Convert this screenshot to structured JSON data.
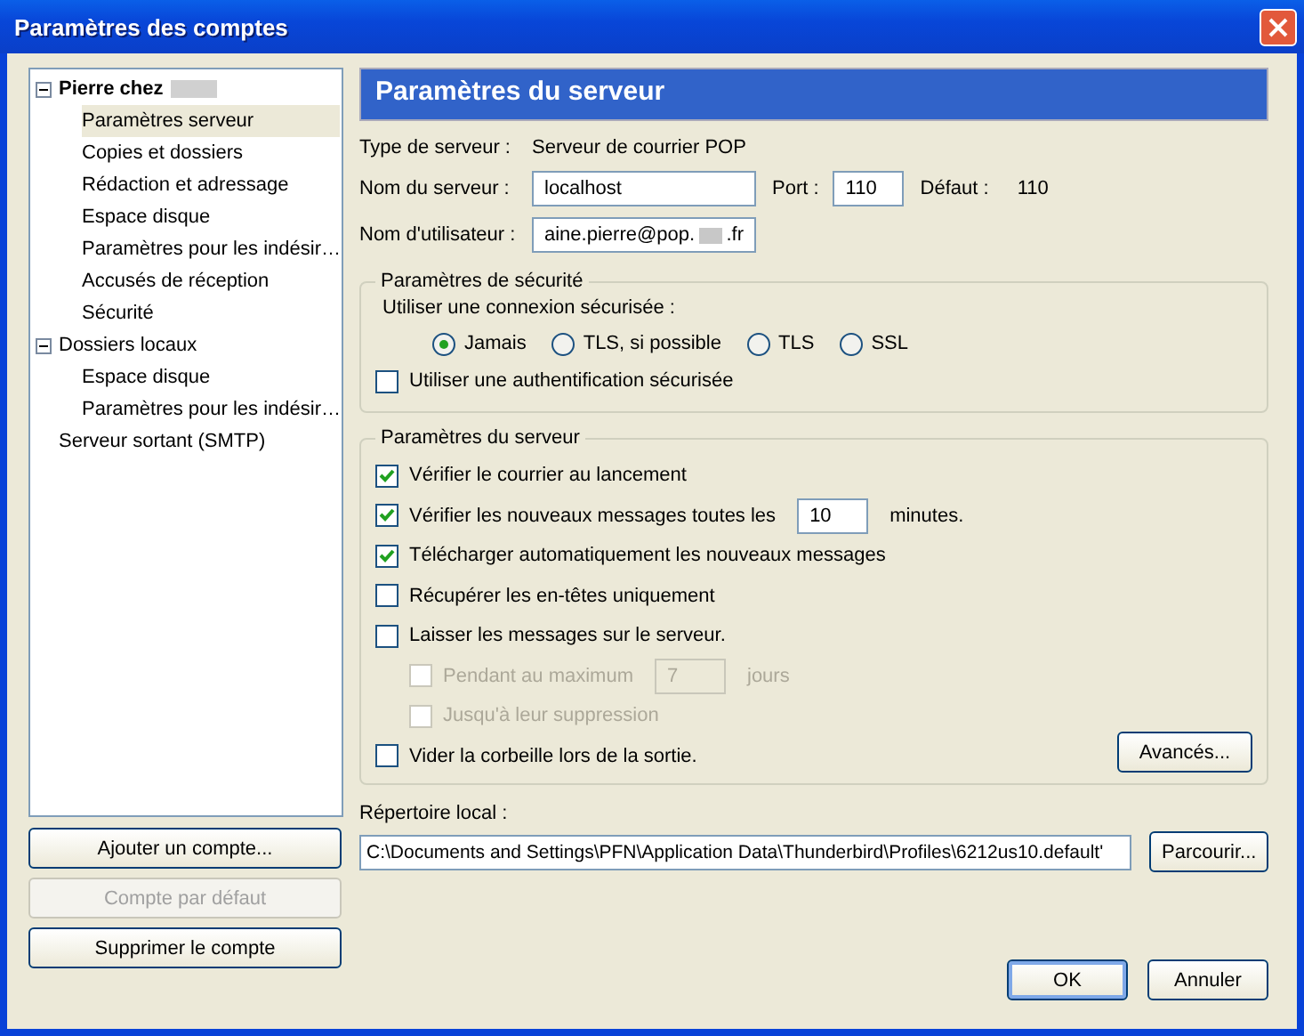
{
  "window": {
    "title": "Paramètres des comptes"
  },
  "tree": [
    {
      "label": "Pierre chez",
      "bold": true,
      "selected": false,
      "expanded": true,
      "children": [
        {
          "label": "Paramètres serveur",
          "selected": true
        },
        {
          "label": "Copies et dossiers",
          "selected": false
        },
        {
          "label": "Rédaction et adressage",
          "selected": false
        },
        {
          "label": "Espace disque",
          "selected": false
        },
        {
          "label": "Paramètres pour les indésir…",
          "selected": false
        },
        {
          "label": "Accusés de réception",
          "selected": false
        },
        {
          "label": "Sécurité",
          "selected": false
        }
      ]
    },
    {
      "label": "Dossiers locaux",
      "bold": false,
      "selected": false,
      "expanded": true,
      "children": [
        {
          "label": "Espace disque",
          "selected": false
        },
        {
          "label": "Paramètres pour les indésir…",
          "selected": false
        }
      ]
    },
    {
      "label": "Serveur sortant (SMTP)",
      "bold": false,
      "selected": false
    }
  ],
  "left_buttons": [
    {
      "label": "Ajouter un compte...",
      "disabled": false
    },
    {
      "label": "Compte par défaut",
      "disabled": true
    },
    {
      "label": "Supprimer le compte",
      "disabled": false
    }
  ],
  "panel": {
    "title": "Paramètres du serveur"
  },
  "server_type": {
    "label": "Type de serveur :",
    "value": "Serveur de courrier POP"
  },
  "server_name": {
    "label": "Nom du serveur :",
    "value": "localhost"
  },
  "port": {
    "label": "Port :",
    "value": "110"
  },
  "default_port": {
    "label": "Défaut :",
    "value": "110"
  },
  "username": {
    "label": "Nom d'utilisateur :",
    "value_start": "aine.pierre@pop.",
    "value_end": ".fr"
  },
  "security": {
    "title": "Paramètres de sécurité",
    "prompt": "Utiliser une connexion sécurisée :",
    "radios": [
      {
        "label": "Jamais",
        "selected": true
      },
      {
        "label": "TLS, si possible",
        "selected": false
      },
      {
        "label": "TLS",
        "selected": false
      },
      {
        "label": "SSL",
        "selected": false
      }
    ],
    "auth": {
      "label": "Utiliser une authentification sécurisée",
      "checked": false
    }
  },
  "server_settings": {
    "title": "Paramètres du serveur",
    "options": [
      {
        "kind": "checkbox",
        "label": "Vérifier le courrier au lancement",
        "checked": true,
        "disabled": false
      },
      {
        "kind": "number",
        "label": "Vérifier les nouveaux messages toutes les",
        "value": "10",
        "suffix": "minutes.",
        "checked": true,
        "disabled": false
      },
      {
        "kind": "checkbox",
        "label": "Télécharger automatiquement les nouveaux messages",
        "checked": true,
        "disabled": false
      },
      {
        "kind": "checkbox",
        "label": "Récupérer les en-têtes uniquement",
        "checked": false,
        "disabled": false
      },
      {
        "kind": "checkbox",
        "label": "Laisser les messages sur le serveur.",
        "checked": false,
        "disabled": false,
        "children": [
          {
            "kind": "number",
            "label": "Pendant au maximum",
            "value": "7",
            "suffix": "jours",
            "checked": false,
            "disabled": true
          },
          {
            "kind": "checkbox",
            "label": "Jusqu'à leur suppression",
            "checked": false,
            "disabled": true
          }
        ]
      },
      {
        "kind": "checkbox",
        "label": "Vider la corbeille lors de la sortie.",
        "checked": false,
        "disabled": false
      }
    ],
    "advanced_button": "Avancés..."
  },
  "local_dir": {
    "label": "Répertoire local :",
    "value": "C:\\Documents and Settings\\PFN\\Application Data\\Thunderbird\\Profiles\\6212us10.default'",
    "button": "Parcourir..."
  },
  "footer_buttons": [
    {
      "label": "OK",
      "default": true
    },
    {
      "label": "Annuler",
      "default": false
    }
  ]
}
